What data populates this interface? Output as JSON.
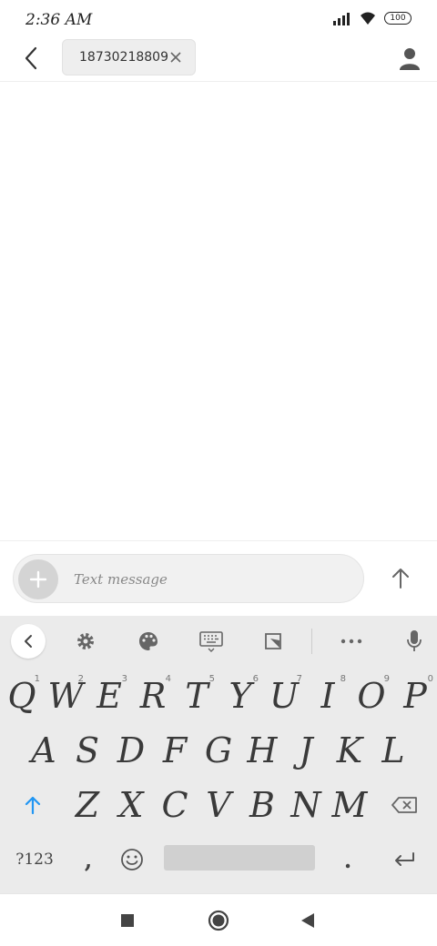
{
  "status_bar": {
    "time": "2:36 AM",
    "battery": "100"
  },
  "header": {
    "recipient": "18730218809"
  },
  "compose": {
    "placeholder": "Text message"
  },
  "keyboard": {
    "row1": [
      {
        "key": "Q",
        "hint": "1"
      },
      {
        "key": "W",
        "hint": "2"
      },
      {
        "key": "E",
        "hint": "3"
      },
      {
        "key": "R",
        "hint": "4"
      },
      {
        "key": "T",
        "hint": "5"
      },
      {
        "key": "Y",
        "hint": "6"
      },
      {
        "key": "U",
        "hint": "7"
      },
      {
        "key": "I",
        "hint": "8"
      },
      {
        "key": "O",
        "hint": "9"
      },
      {
        "key": "P",
        "hint": "0"
      }
    ],
    "row2": [
      "A",
      "S",
      "D",
      "F",
      "G",
      "H",
      "J",
      "K",
      "L"
    ],
    "row3": [
      "Z",
      "X",
      "C",
      "V",
      "B",
      "N",
      "M"
    ],
    "symbols_label": "?123",
    "comma": ",",
    "period": "."
  },
  "colors": {
    "shift_accent": "#2196f3",
    "keyboard_bg": "#ebebeb"
  }
}
